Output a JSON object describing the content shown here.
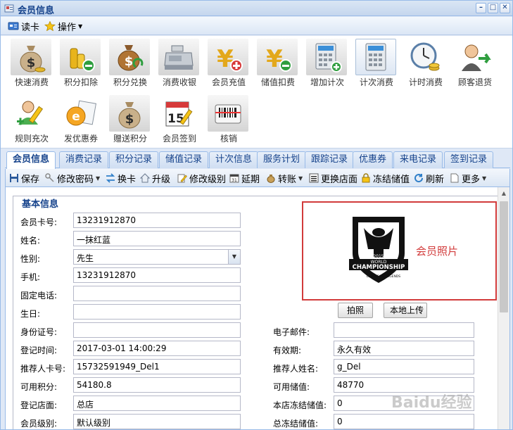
{
  "window": {
    "title": "会员信息"
  },
  "menu": {
    "read_card": "读卡",
    "operations": "操作"
  },
  "tools_row1": [
    {
      "name": "quick-consume",
      "label": "快速消费"
    },
    {
      "name": "points-deduct",
      "label": "积分扣除"
    },
    {
      "name": "points-exchange",
      "label": "积分兑换"
    },
    {
      "name": "consume-cashier",
      "label": "消费收银"
    },
    {
      "name": "member-recharge",
      "label": "会员充值"
    },
    {
      "name": "stored-deduct",
      "label": "储值扣费"
    },
    {
      "name": "add-count",
      "label": "增加计次"
    },
    {
      "name": "count-consume",
      "label": "计次消费"
    },
    {
      "name": "timed-consume",
      "label": "计时消费"
    },
    {
      "name": "customer-refund",
      "label": "顾客退货"
    }
  ],
  "tools_row2": [
    {
      "name": "rule-recharge",
      "label": "规则充次"
    },
    {
      "name": "issue-coupon",
      "label": "发优惠券"
    },
    {
      "name": "gift-points",
      "label": "赠送积分"
    },
    {
      "name": "member-checkin",
      "label": "会员签到"
    },
    {
      "name": "verify",
      "label": "核销"
    }
  ],
  "tabs": [
    "会员信息",
    "消费记录",
    "积分记录",
    "储值记录",
    "计次信息",
    "服务计划",
    "跟踪记录",
    "优惠券",
    "来电记录",
    "签到记录"
  ],
  "actions": {
    "save": "保存",
    "change_password": "修改密码",
    "swap_card": "换卡",
    "upgrade": "升级",
    "change_level": "修改级别",
    "extend": "延期",
    "transfer": "转账",
    "change_store": "更换店面",
    "freeze_stored": "冻结储值",
    "refresh": "刷新",
    "more": "更多"
  },
  "form": {
    "section_title": "基本信息",
    "card_no_label": "会员卡号:",
    "card_no": "13231912870",
    "name_label": "姓名:",
    "name": "一抹红蓝",
    "gender_label": "性别:",
    "gender": "先生",
    "phone_label": "手机:",
    "phone": "13231912870",
    "landline_label": "固定电话:",
    "landline": "",
    "birthday_label": "生日:",
    "birthday": "",
    "id_no_label": "身份证号:",
    "id_no": "",
    "email_label": "电子邮件:",
    "email": "",
    "reg_time_label": "登记时间:",
    "reg_time": "2017-03-01 14:00:29",
    "valid_label": "有效期:",
    "valid": "永久有效",
    "referrer_card_label": "推荐人卡号:",
    "referrer_card": "15732591949_Del1",
    "referrer_name_label": "推荐人姓名:",
    "referrer_name": "g_Del",
    "points_label": "可用积分:",
    "points": "54180.8",
    "stored_label": "可用储值:",
    "stored": "48770",
    "reg_store_label": "登记店面:",
    "reg_store": "总店",
    "store_frozen_label": "本店冻结储值:",
    "store_frozen": "0",
    "level_label": "会员级别:",
    "level": "默认级别",
    "total_frozen_label": "总冻结储值:",
    "total_frozen": "0"
  },
  "photo": {
    "label": "会员照片",
    "take_photo": "拍照",
    "local_upload": "本地上传",
    "logo": {
      "year": "2015",
      "line1": "WORLD",
      "line2": "CHAMPIONSHIP",
      "line3": "LEAGUE OF LEGENDS"
    }
  },
  "watermark": "Baidu经验",
  "colors": {
    "accent": "#15428b",
    "border": "#99bbe8",
    "photo_border": "#d23b3b"
  }
}
